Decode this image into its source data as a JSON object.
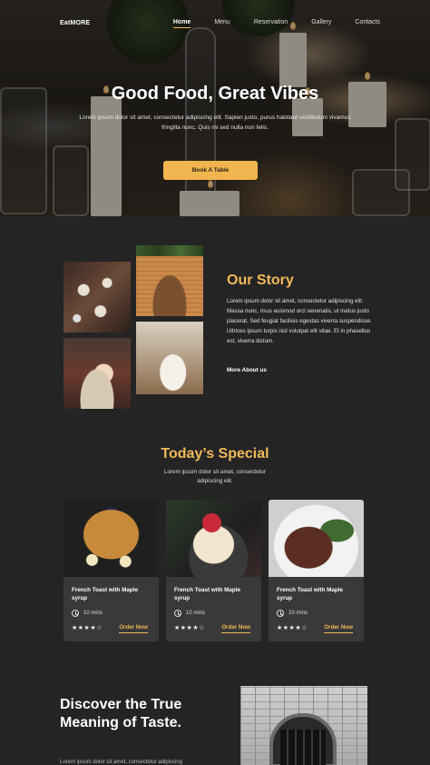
{
  "brand": "EatMORE",
  "nav": {
    "links": [
      "Home",
      "Menu",
      "Reservation",
      "Gallery",
      "Contacts"
    ],
    "active": "Home"
  },
  "hero": {
    "title": "Good Food, Great Vibes",
    "text": "Lorem ipsum dolor sit amet, consectetur adipiscing elit. Sapien justo, purus habitant vestibulum vivamus fringilla nunc. Quis mi sed nulla non felis.",
    "cta": "Book A Table"
  },
  "story": {
    "title": "Our Story",
    "text": "Lorem ipsum dolor sit amet, consectetur adipiscing elit. Massa nunc, risus euismod orci venenatis, ut metus justo placerat. Sed feugiat facilisis egestas viverra suspendisse. Ultrices ipsum turpis nisl volutpat elit vitae. Et in phasellus est, viverra dictum.",
    "link": "More About us"
  },
  "special": {
    "title": "Today’s Special",
    "subtitle": "Lorem ipsum dolor sit amet, consectetur adipiscing elit.",
    "cards": [
      {
        "name": "French Toast with Maple syrup",
        "time": "10 mins",
        "rating": "★★★★☆",
        "order": "Order Now"
      },
      {
        "name": "French Toast with Maple syrup",
        "time": "10 mins",
        "rating": "★★★★☆",
        "order": "Order Now"
      },
      {
        "name": "French Toast with Maple syrup",
        "time": "10 mins",
        "rating": "★★★★☆",
        "order": "Order Now"
      }
    ]
  },
  "discover": {
    "title": "Discover the True Meaning of Taste.",
    "text": "Lorem ipsum dolor sit amet, consectetur adipiscing"
  },
  "colors": {
    "accent": "#f0b95a",
    "background": "#242424",
    "card": "#393939"
  }
}
